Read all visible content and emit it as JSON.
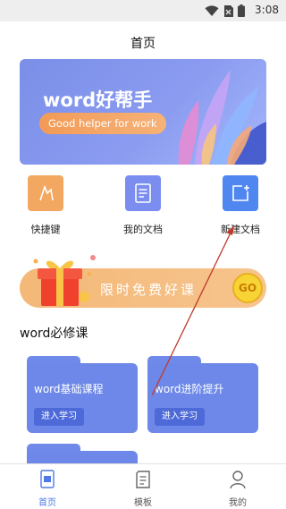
{
  "status_bar": {
    "time": "3:08",
    "icons": [
      "wifi-icon",
      "sim-off-icon",
      "battery-icon"
    ]
  },
  "header": {
    "title": "首页"
  },
  "banner": {
    "title": "word好帮手",
    "subtitle": "Good helper for work"
  },
  "quick_actions": [
    {
      "label": "快捷键",
      "icon": "shortcut-icon",
      "color": "#f2a860"
    },
    {
      "label": "我的文档",
      "icon": "document-icon",
      "color": "#7b8ef0"
    },
    {
      "label": "新建文档",
      "icon": "new-document-icon",
      "color": "#4f86f0"
    }
  ],
  "promo": {
    "text": "限时免费好课",
    "go_label": "GO"
  },
  "section": {
    "title": "word必修课"
  },
  "courses": [
    {
      "title": "word基础课程",
      "button": "进入学习"
    },
    {
      "title": "word进阶提升",
      "button": "进入学习"
    }
  ],
  "bottom_nav": {
    "active_color": "#4f7ae8",
    "items": [
      {
        "label": "首页",
        "icon": "home-doc-icon",
        "active": true
      },
      {
        "label": "模板",
        "icon": "template-icon",
        "active": false
      },
      {
        "label": "我的",
        "icon": "profile-icon",
        "active": false
      }
    ]
  }
}
